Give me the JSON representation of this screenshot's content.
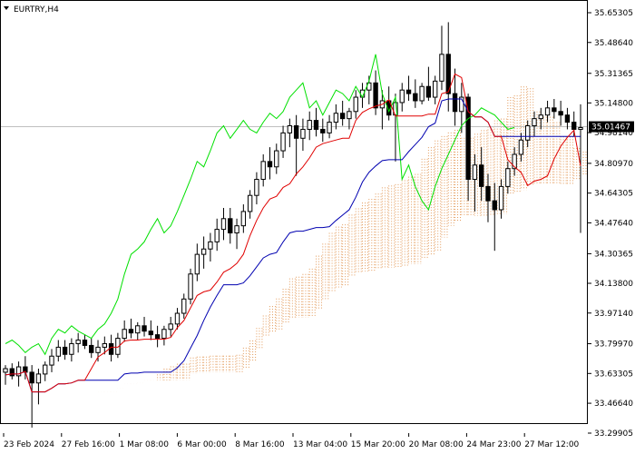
{
  "window": {
    "title": "EURTRY,H4"
  },
  "price_axis": {
    "min": 33.29905,
    "max": 35.65305,
    "ticks": [
      "35.65305",
      "35.48640",
      "35.31365",
      "35.14800",
      "34.98140",
      "34.80970",
      "34.64305",
      "34.47640",
      "34.30365",
      "34.13800",
      "33.97140",
      "33.79970",
      "33.63305",
      "33.46640",
      "33.29905"
    ]
  },
  "time_axis": {
    "labels": [
      "23 Feb 2024",
      "27 Feb 16:00",
      "1 Mar 08:00",
      "6 Mar 00:00",
      "8 Mar 16:00",
      "13 Mar 04:00",
      "15 Mar 20:00",
      "20 Mar 08:00",
      "24 Mar 23:00",
      "27 Mar 12:00"
    ]
  },
  "bid": {
    "value": "35.01467",
    "bg_color": "#000000"
  },
  "colors": {
    "bull": "#000000",
    "bear": "#000000",
    "tenkan": "#e00000",
    "kijun": "#0000b0",
    "chikou": "#00e000",
    "cloud": "#e39a5a",
    "grid_line": "#c0c0c0"
  },
  "chart_data": {
    "type": "candlestick",
    "title": "EURTRY,H4",
    "ylim": [
      33.29905,
      35.65305
    ],
    "candles": [
      [
        33.64,
        33.68,
        33.57,
        33.66
      ],
      [
        33.66,
        33.69,
        33.6,
        33.62
      ],
      [
        33.62,
        33.7,
        33.56,
        33.67
      ],
      [
        33.67,
        33.73,
        33.6,
        33.64
      ],
      [
        33.64,
        33.68,
        33.33,
        33.58
      ],
      [
        33.58,
        33.66,
        33.46,
        33.63
      ],
      [
        33.63,
        33.7,
        33.59,
        33.68
      ],
      [
        33.68,
        33.77,
        33.64,
        33.73
      ],
      [
        33.73,
        33.82,
        33.7,
        33.78
      ],
      [
        33.78,
        33.82,
        33.71,
        33.74
      ],
      [
        33.74,
        33.83,
        33.7,
        33.8
      ],
      [
        33.8,
        33.86,
        33.75,
        33.82
      ],
      [
        33.82,
        33.85,
        33.77,
        33.79
      ],
      [
        33.79,
        33.83,
        33.72,
        33.75
      ],
      [
        33.75,
        33.82,
        33.7,
        33.78
      ],
      [
        33.78,
        33.84,
        33.74,
        33.8
      ],
      [
        33.8,
        33.85,
        33.7,
        33.74
      ],
      [
        33.74,
        33.86,
        33.72,
        33.83
      ],
      [
        33.83,
        33.93,
        33.81,
        33.88
      ],
      [
        33.88,
        33.94,
        33.83,
        33.86
      ],
      [
        33.86,
        33.92,
        33.82,
        33.9
      ],
      [
        33.9,
        33.95,
        33.84,
        33.87
      ],
      [
        33.87,
        33.93,
        33.82,
        33.85
      ],
      [
        33.85,
        33.9,
        33.78,
        33.83
      ],
      [
        33.83,
        33.9,
        33.79,
        33.88
      ],
      [
        33.88,
        33.95,
        33.84,
        33.91
      ],
      [
        33.91,
        34.0,
        33.88,
        33.97
      ],
      [
        33.97,
        34.08,
        33.94,
        34.05
      ],
      [
        34.05,
        34.22,
        34.02,
        34.19
      ],
      [
        34.19,
        34.36,
        34.15,
        34.3
      ],
      [
        34.3,
        34.4,
        34.22,
        34.33
      ],
      [
        34.33,
        34.42,
        34.26,
        34.37
      ],
      [
        34.37,
        34.5,
        34.32,
        34.44
      ],
      [
        34.44,
        34.56,
        34.38,
        34.5
      ],
      [
        34.5,
        34.56,
        34.36,
        34.42
      ],
      [
        34.42,
        34.5,
        34.33,
        34.46
      ],
      [
        34.46,
        34.58,
        34.42,
        34.54
      ],
      [
        34.54,
        34.66,
        34.5,
        34.63
      ],
      [
        34.63,
        34.76,
        34.58,
        34.72
      ],
      [
        34.72,
        34.86,
        34.68,
        34.82
      ],
      [
        34.82,
        34.9,
        34.72,
        34.79
      ],
      [
        34.79,
        34.92,
        34.75,
        34.88
      ],
      [
        34.88,
        35.02,
        34.84,
        34.98
      ],
      [
        34.98,
        35.06,
        34.9,
        35.02
      ],
      [
        35.02,
        35.08,
        34.74,
        34.95
      ],
      [
        34.95,
        35.06,
        34.88,
        35.0
      ],
      [
        35.0,
        35.1,
        34.94,
        35.05
      ],
      [
        35.05,
        35.12,
        34.96,
        35.0
      ],
      [
        35.0,
        35.06,
        34.93,
        34.98
      ],
      [
        34.98,
        35.08,
        34.95,
        35.04
      ],
      [
        35.04,
        35.14,
        35.0,
        35.09
      ],
      [
        35.09,
        35.16,
        35.02,
        35.06
      ],
      [
        35.06,
        35.12,
        35.0,
        35.1
      ],
      [
        35.1,
        35.22,
        35.06,
        35.18
      ],
      [
        35.18,
        35.26,
        35.12,
        35.22
      ],
      [
        35.22,
        35.3,
        35.14,
        35.26
      ],
      [
        35.26,
        35.33,
        35.08,
        35.12
      ],
      [
        35.12,
        35.22,
        35.0,
        35.16
      ],
      [
        35.16,
        35.24,
        35.05,
        35.08
      ],
      [
        35.08,
        35.2,
        34.82,
        35.15
      ],
      [
        35.15,
        35.26,
        35.1,
        35.22
      ],
      [
        35.22,
        35.3,
        35.16,
        35.2
      ],
      [
        35.2,
        35.28,
        35.12,
        35.16
      ],
      [
        35.16,
        35.26,
        35.14,
        35.24
      ],
      [
        35.24,
        35.35,
        35.16,
        35.18
      ],
      [
        35.18,
        35.3,
        35.14,
        35.27
      ],
      [
        35.27,
        35.58,
        35.22,
        35.42
      ],
      [
        35.42,
        35.6,
        35.1,
        35.2
      ],
      [
        35.2,
        35.34,
        35.02,
        35.1
      ],
      [
        35.1,
        35.26,
        34.98,
        35.18
      ],
      [
        35.18,
        35.2,
        34.6,
        34.72
      ],
      [
        34.72,
        34.86,
        34.54,
        34.8
      ],
      [
        34.8,
        34.9,
        34.6,
        34.68
      ],
      [
        34.68,
        34.75,
        34.48,
        34.6
      ],
      [
        34.6,
        34.7,
        34.32,
        34.55
      ],
      [
        34.55,
        34.72,
        34.5,
        34.68
      ],
      [
        34.68,
        34.82,
        34.64,
        34.78
      ],
      [
        34.78,
        34.9,
        34.74,
        34.86
      ],
      [
        34.86,
        34.98,
        34.82,
        34.94
      ],
      [
        34.94,
        35.05,
        34.9,
        35.02
      ],
      [
        35.02,
        35.1,
        34.96,
        35.06
      ],
      [
        35.06,
        35.12,
        35.0,
        35.08
      ],
      [
        35.08,
        35.16,
        35.04,
        35.12
      ],
      [
        35.12,
        35.17,
        35.06,
        35.1
      ],
      [
        35.1,
        35.16,
        35.02,
        35.08
      ],
      [
        35.08,
        35.12,
        35.0,
        35.04
      ],
      [
        35.04,
        35.1,
        34.96,
        35.0
      ],
      [
        35.0,
        35.14,
        34.42,
        35.01
      ]
    ]
  }
}
